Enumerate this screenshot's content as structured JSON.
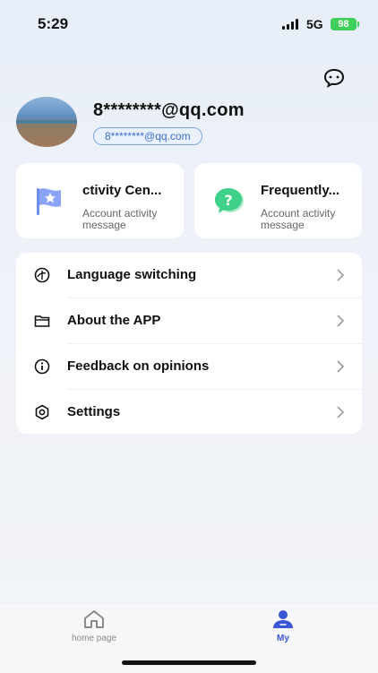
{
  "status_bar": {
    "time": "5:29",
    "network": "5G",
    "battery": "98"
  },
  "profile": {
    "name": "8********@qq.com",
    "email": "8********@qq.com"
  },
  "cards": [
    {
      "title": "ctivity Cen...",
      "subtitle": "Account activity message",
      "icon": "flag-star-icon"
    },
    {
      "title": "Frequently...",
      "subtitle": "Account activity message",
      "icon": "question-bubble-icon"
    }
  ],
  "menu": [
    {
      "label": "Language switching",
      "icon": "language-icon"
    },
    {
      "label": "About the APP",
      "icon": "folder-icon"
    },
    {
      "label": "Feedback on opinions",
      "icon": "info-icon"
    },
    {
      "label": "Settings",
      "icon": "hexagon-settings-icon"
    }
  ],
  "nav": {
    "home": "home page",
    "my": "My"
  },
  "colors": {
    "accent": "#3a57d6",
    "battery": "#3fcf5c",
    "card_bg": "#ffffff"
  }
}
